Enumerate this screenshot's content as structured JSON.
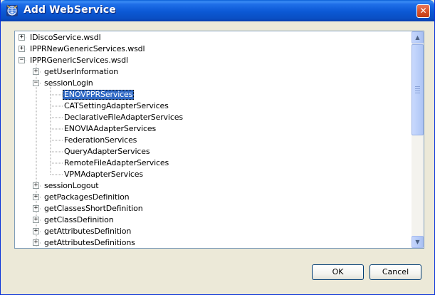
{
  "window": {
    "title": "Add WebService",
    "close_glyph": "✕",
    "icon": "app-globe-icon"
  },
  "tree": {
    "items": [
      {
        "label": "IDiscoService.wsdl",
        "expander": "+",
        "level": 0
      },
      {
        "label": "IPPRNewGenericServices.wsdl",
        "expander": "+",
        "level": 0
      },
      {
        "label": "IPPRGenericServices.wsdl",
        "expander": "−",
        "level": 0
      },
      {
        "label": "getUserInformation",
        "expander": "+",
        "level": 1
      },
      {
        "label": "sessionLogin",
        "expander": "−",
        "level": 1
      },
      {
        "label": "ENOVPPRServices",
        "expander": "",
        "level": 2,
        "selected": true
      },
      {
        "label": "CATSettingAdapterServices",
        "expander": "",
        "level": 2
      },
      {
        "label": "DeclarativeFileAdapterServices",
        "expander": "",
        "level": 2
      },
      {
        "label": "ENOVIAAdapterServices",
        "expander": "",
        "level": 2
      },
      {
        "label": "FederationServices",
        "expander": "",
        "level": 2
      },
      {
        "label": "QueryAdapterServices",
        "expander": "",
        "level": 2
      },
      {
        "label": "RemoteFileAdapterServices",
        "expander": "",
        "level": 2
      },
      {
        "label": "VPMAdapterServices",
        "expander": "",
        "level": 2
      },
      {
        "label": "sessionLogout",
        "expander": "+",
        "level": 1
      },
      {
        "label": "getPackagesDefinition",
        "expander": "+",
        "level": 1
      },
      {
        "label": "getClassesShortDefinition",
        "expander": "+",
        "level": 1
      },
      {
        "label": "getClassDefinition",
        "expander": "+",
        "level": 1
      },
      {
        "label": "getAttributesDefinition",
        "expander": "+",
        "level": 1
      },
      {
        "label": "getAttributesDefinitions",
        "expander": "+",
        "level": 1
      }
    ]
  },
  "scrollbar": {
    "up_glyph": "▲",
    "down_glyph": "▼",
    "position_fraction": 0.0
  },
  "buttons": {
    "ok_label": "OK",
    "cancel_label": "Cancel"
  },
  "colors": {
    "selection": "#316ac5",
    "titlebar": "#0a58d4",
    "close": "#d9542a"
  }
}
